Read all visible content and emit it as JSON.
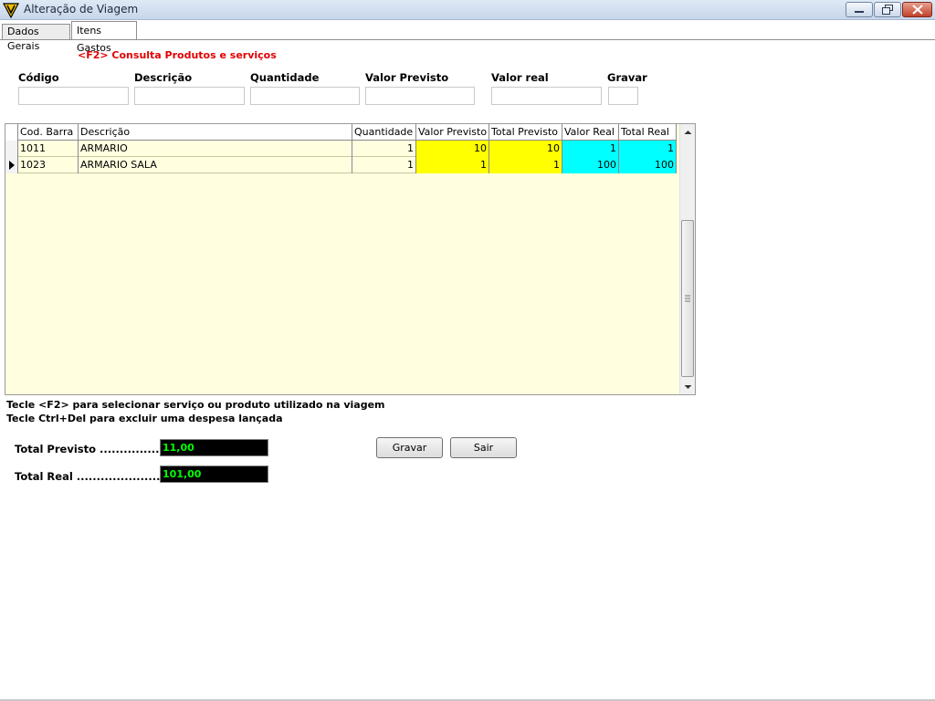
{
  "window": {
    "title": "Alteração de Viagem",
    "logo_icon": "app-logo-icon"
  },
  "tabs": [
    {
      "label": "Dados Gerais",
      "active": false
    },
    {
      "label": "Itens Gastos",
      "active": true
    }
  ],
  "hint_f2": "<F2> Consulta Produtos e serviços",
  "fields": {
    "codigo": {
      "label": "Código",
      "value": ""
    },
    "descricao": {
      "label": "Descrição",
      "value": ""
    },
    "quantidade": {
      "label": "Quantidade",
      "value": ""
    },
    "valor_previsto": {
      "label": "Valor Previsto",
      "value": ""
    },
    "valor_real": {
      "label": "Valor real",
      "value": ""
    },
    "gravar": {
      "label": "Gravar",
      "value": ""
    }
  },
  "grid": {
    "columns": [
      "Cod. Barra",
      "Descrição",
      "Quantidade",
      "Valor Previsto",
      "Total Previsto",
      "Valor Real",
      "Total Real"
    ],
    "rows": [
      {
        "cod_barra": "1011",
        "descricao": "ARMARIO",
        "quantidade": "1",
        "valor_previsto": "10",
        "total_previsto": "10",
        "valor_real": "1",
        "total_real": "1",
        "current": false
      },
      {
        "cod_barra": "1023",
        "descricao": "ARMARIO SALA",
        "quantidade": "1",
        "valor_previsto": "1",
        "total_previsto": "1",
        "valor_real": "100",
        "total_real": "100",
        "current": true
      }
    ]
  },
  "help": {
    "line1": "Tecle <F2> para selecionar serviço ou produto utilizado na viagem",
    "line2": "Tecle Ctrl+Del para excluir uma despesa lançada"
  },
  "totals": {
    "previsto_label": "Total Previsto ..................:",
    "previsto_value": "11,00",
    "real_label": "Total Real ........................:",
    "real_value": "101,00"
  },
  "buttons": {
    "gravar": "Gravar",
    "sair": "Sair"
  },
  "colors": {
    "hint": "#e00000",
    "grid_bg": "#ffffdf",
    "previsto_cells": "#ffff00",
    "real_cells": "#00ffff",
    "total_text": "#00ff00"
  }
}
